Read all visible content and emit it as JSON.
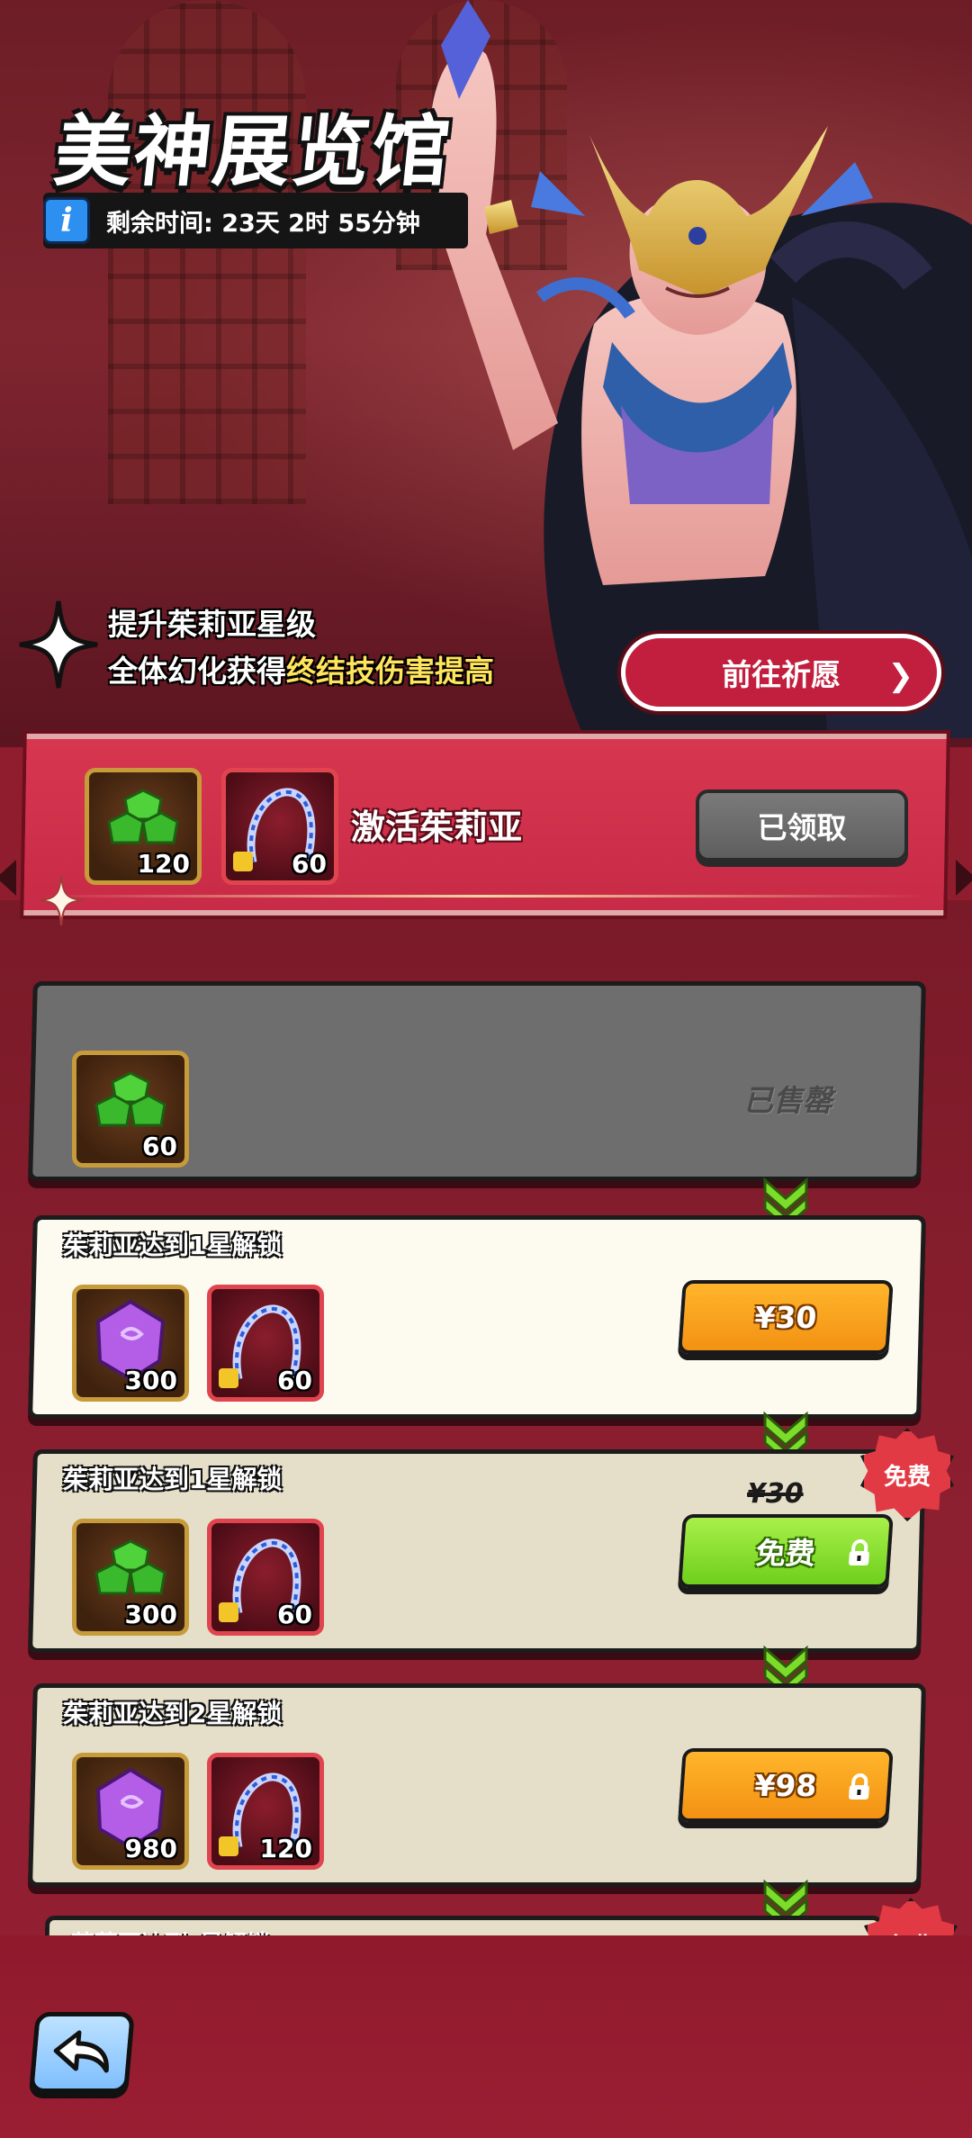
{
  "header": {
    "title": "美神展览馆",
    "info_icon_glyph": "i",
    "remaining_time": "剩余时间: 23天 2时 55分钟"
  },
  "promo": {
    "line1": "提升茱莉亚星级",
    "line2_prefix": "全体幻化获得",
    "line2_highlight": "终结技伤害提高",
    "highlight_color": "#ffe45c",
    "pray_button": "前往祈愿"
  },
  "activation": {
    "label": "激活茱莉亚",
    "claimed_button": "已领取",
    "rewards": [
      {
        "icon": "green-gem-icon",
        "qty": "120"
      },
      {
        "icon": "whip-fragment-icon",
        "qty": "60"
      }
    ]
  },
  "tiers": [
    {
      "status": "已售罄",
      "rewards": [
        {
          "icon": "green-gem-icon",
          "qty": "60"
        }
      ]
    },
    {
      "title": "茱莉亚达到1星解锁",
      "rewards": [
        {
          "icon": "purple-crystal-icon",
          "qty": "300"
        },
        {
          "icon": "whip-fragment-icon",
          "qty": "60"
        }
      ],
      "button": "¥30"
    },
    {
      "title": "茱莉亚达到1星解锁",
      "rewards": [
        {
          "icon": "green-gem-icon",
          "qty": "300"
        },
        {
          "icon": "whip-fragment-icon",
          "qty": "60"
        }
      ],
      "original_price": "¥30",
      "badge": "免费",
      "button": "免费",
      "locked": true
    },
    {
      "title": "茱莉亚达到2星解锁",
      "rewards": [
        {
          "icon": "purple-crystal-icon",
          "qty": "980"
        },
        {
          "icon": "whip-fragment-icon",
          "qty": "120"
        }
      ],
      "button": "¥98",
      "locked": true
    }
  ],
  "peek_card": {
    "title": "茱莉亚达到_星解锁",
    "badge": "免费"
  },
  "colors": {
    "accent_red": "#c21f3e",
    "orange_button": "#f39113",
    "green_button": "#6fcf1c",
    "badge_red": "#e23a44",
    "chevron_green": "#7ddb2a"
  },
  "nav": {
    "back_icon": "back-arrow-icon"
  }
}
